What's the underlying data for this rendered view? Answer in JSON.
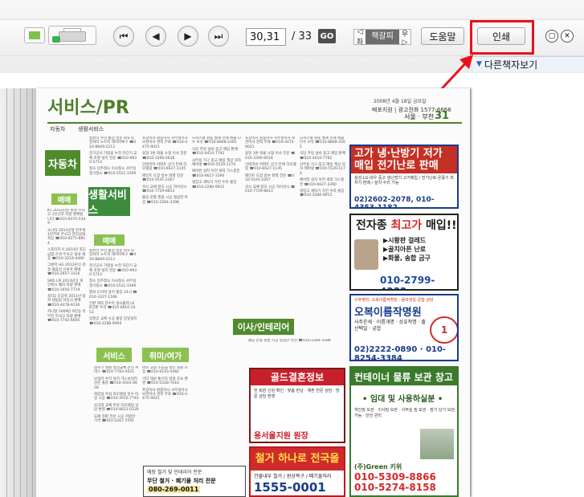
{
  "toolbar": {
    "page_current": "30,31",
    "page_total": "/ 33",
    "go_label": "GO",
    "bookmark_left": "◁좌",
    "bookmark_label": "책갈피",
    "bookmark_right": "우▷",
    "help_label": "도움말",
    "print_label": "인쇄",
    "nav_first": "⏮",
    "nav_prev": "◀",
    "nav_next": "▶",
    "nav_last": "⏭",
    "min_label": "▢",
    "close_label": "✕"
  },
  "side_panel": {
    "other_books_label": "다른책자보기"
  },
  "highlight": {
    "color": "#e8121b",
    "target": "print-button"
  },
  "newspaper": {
    "title": "서비스/PR",
    "subtitle_left": "자동차",
    "subtitle_right": "생활서비스",
    "date": "2008년 4월 18일 금요일",
    "phone": "배포지원 | 광고전화 1577-6666",
    "region": "서울 · 부천",
    "page_number": "31",
    "categories": {
      "auto": "자동차",
      "auto_sale": "매매",
      "life_service": "생활서비스",
      "life_sale": "매매",
      "service": "서비스",
      "hobby": "취미/여가",
      "interior": "이사/인테리어"
    },
    "ads": {
      "heating": {
        "headline": "고가 냉·난방기 저가 매입 전기난로 판매",
        "body": "삼성·LG·대우 중고 냉난방기 고가매입 / 전기난로·온풍기 최저가 판매 / 설치·수리 가능",
        "phone": "02)2602-2078, 010-4353-1182"
      },
      "electronics": {
        "headline_prefix": "전자종",
        "headline_highlight": "최고가",
        "headline_suffix": "매입!!",
        "lines": "▶시황판 걸레드\n▶골치아픈 난로\n▶화물, 송합 금구",
        "phone": "010-2799-4332"
      },
      "clinic": {
        "top": "사주명리, 오복이름작명원 · 음력생일 궁합 상담",
        "headline": "오복이름작명원",
        "body": "사주운세 · 이름개명 · 상호작명 · 출산택일 · 궁합",
        "badge": "1",
        "phone": "02)2222-0890 · 010-8254-3384"
      },
      "container": {
        "headline": "컨테이너 물류 보관 창고",
        "sub": "• 임대 및 사용하실분 •",
        "body": "개인짐 보관 · 이사짐 보관 · 사무실 짐 보관 · 장기 단기 보관 가능 · 안전 관리",
        "company": "(주)Green 키위",
        "phone": "010-5309-8866\n010-5274-8158"
      },
      "wedding": {
        "headline": "골드결혼정보",
        "body": "전 회원 신원 확인 · 맞춤 만남 · 재혼 전문 상담 · 방문 상담 환영",
        "phone": "용서울지원 원장 02)599-8820"
      },
      "demolition": {
        "headline": "철거 하나로 전국을",
        "sub": "건물내부 철거 / 원상복구 / 폐기물처리",
        "phone": "1555-0001"
      },
      "classified": {
        "line1": "매장 철거 및 인테리어 전문",
        "line2": "무단 철거 · 폐기물 처리 전문",
        "phone": "080-269-0011"
      }
    },
    "columns": {
      "col1": [
        "K5 2012년형 흰색 무사고 1인신조 차량 판매합니다 ☎010-6470-5349",
        "소나타 2011년형 진주색 1만키로 무사고 관리상태 최상 ☎010-9275-8814",
        "스포티지 R 2010년 최고급형 은색 무사고 실내 깨끗 ☎010-3218-4490",
        "그랜저 HG 2012년식 검정 풀옵션 선루프 매매 ☎010-2957-3316",
        "SM5 LPi 2013년식 개인택시 폐차 차량 판매 ☎010-2450-7719",
        "포터2 초장축 2011년 탑차 냉동탑 이동식 판매 ☎010-4478-9130",
        "카니발 2009년 9인승 리무진 무사고 차량 판매 ☎010-7742-6605"
      ],
      "col2": [
        "컴퓨터 수리 출장 방문 A/S 당일처리 노트북 데이터복구 ☎010-8849-2213",
        "전기공사 가정용 누전 차단기 교체 조명 설치 전문 ☎010-9930-5714",
        "청소 입주청소 이사청소 사무실 정기청소 ☎010-5521-3390",
        "열쇠 도어락 설치 출장 24시 ☎010-3327-1186",
        "간판 제작 현수막 실사출력 LED간판 수리 ☎010-6610-2453",
        "방충망 교체 시공 출장 당일설치 ☎010-2288-9904"
      ],
      "col3": [
        "정수기 렌탈 필터교체 관리 서비스 ☎010-7783-4521",
        "보일러 수리 설치 가스보일러 전문 출장 ☎010-4501-6628",
        "화장실 욕실 리모델링 방수 타일 시공 ☎010-3916-7740",
        "싱크대 교체 주방 리모델링 상담 환영 ☎010-8812-0339",
        "도배 장판 전문 시공 저렴한 가격 ☎010-2267-5591",
        "바둑 교실 초중급 성인 회원 모집 ☎010-6193-4482",
        "기타 레슨 통기타 일렉 초보 환영 ☎010-5528-7016"
      ],
      "col4": [
        "포장이사 원룸이사 사무실이사 보관이사 견적 무료 ☎010-4475-9021",
        "용달 1톤 화물 소형 이사 전문 ☎010-3390-6618",
        "인테리어 아파트 상가 전체 리모델링 ☎010-6627-1145",
        "페인트 도장 방수 외벽 전문 ☎010-5541-2267",
        "샷시 교체 창호 시공 하이샷시 ☎010-7729-8813",
        "몰딩 문틀 필름 시공 깔끔한 마감 ☎010-2284-3398"
      ],
      "col5": [
        "오피스텔 원룸 월세 전세 매물 다수 보유 ☎010-8848-2265",
        "식당 주방 설비 중고 매입 판매 ☎010-4410-7792",
        "사무용 가구 중고 매입 책상 의자 캐비넷 ☎010-5529-1174",
        "에어컨 설치 이전 세척 가스충전 ☎010-6627-3390",
        "냉장고 세탁기 가전 수리 출장 ☎010-2280-9915"
      ]
    }
  }
}
